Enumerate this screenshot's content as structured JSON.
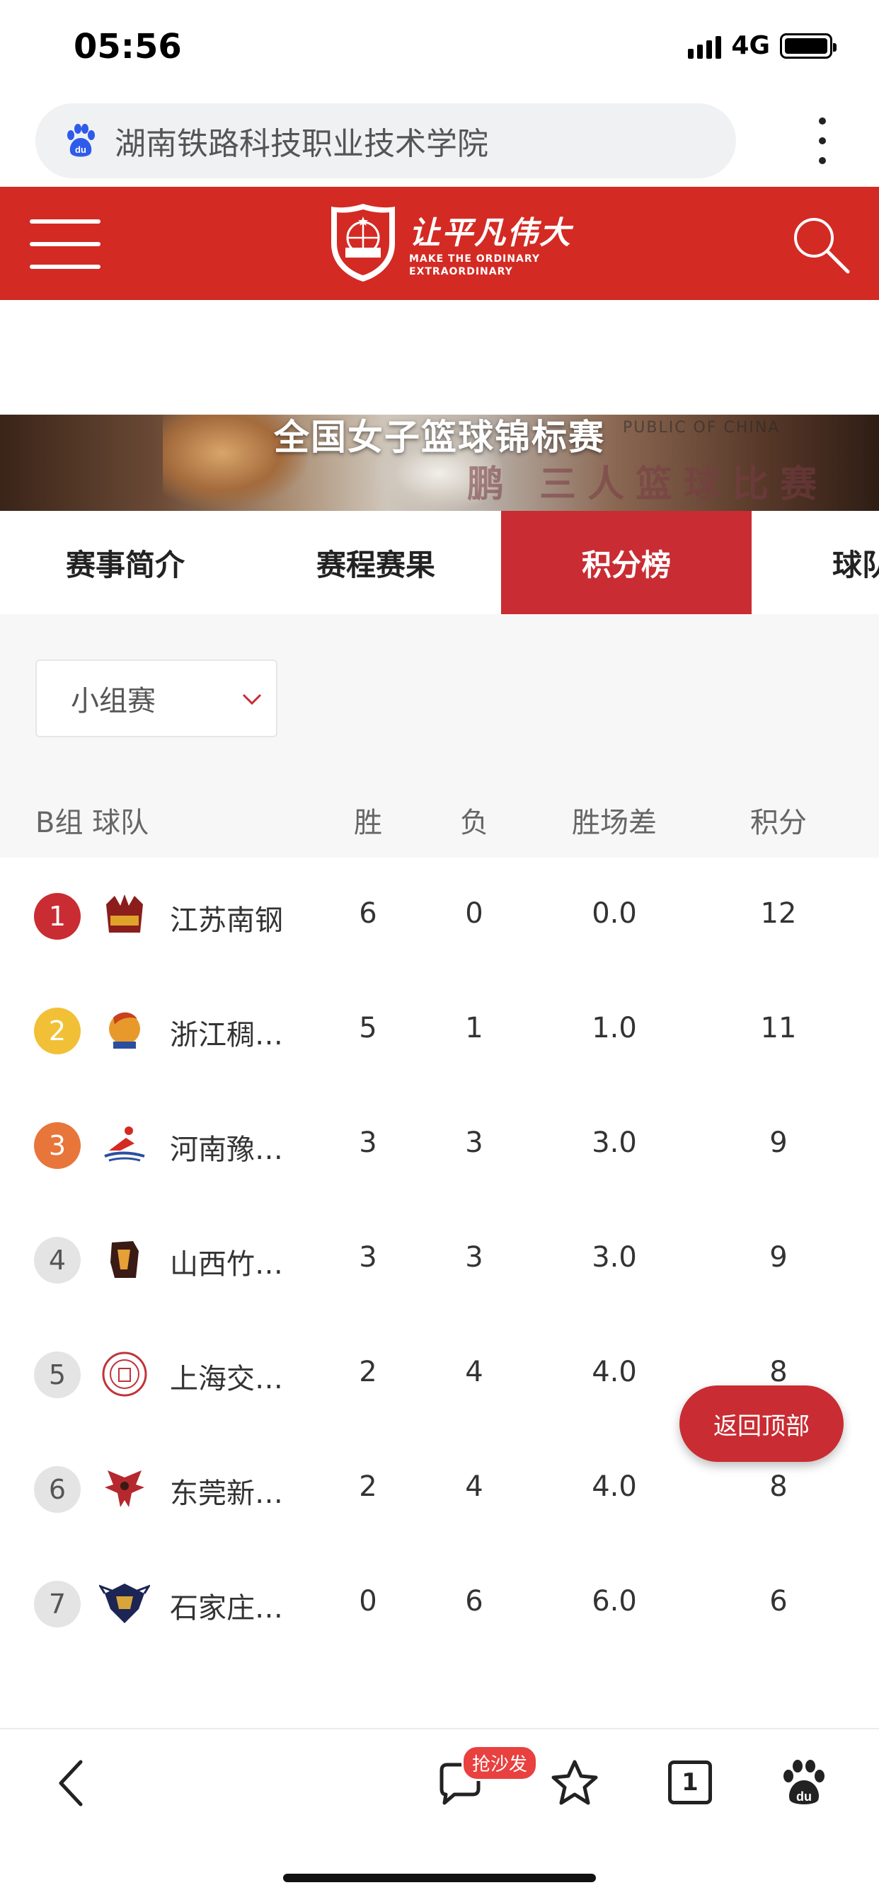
{
  "status_bar": {
    "time": "05:56",
    "network": "4G"
  },
  "address_bar": {
    "text": "湖南铁路科技职业技术学院"
  },
  "header": {
    "slogan": "让平凡伟大",
    "slogan_en_line1": "MAKE THE ORDINARY",
    "slogan_en_line2": "EXTRAORDINARY",
    "brand_color": "#d42a24"
  },
  "banner": {
    "title": "全国女子篮球锦标赛",
    "subtitle": "鹏 三人篮球比赛",
    "english_fragment": "PUBLIC OF CHINA"
  },
  "tabs": [
    {
      "label": "赛事简介",
      "active": false
    },
    {
      "label": "赛程赛果",
      "active": false
    },
    {
      "label": "积分榜",
      "active": true
    },
    {
      "label": "球队数",
      "active": false
    }
  ],
  "filter": {
    "stage": "小组赛"
  },
  "table": {
    "headers": {
      "group_team": "B组  球队",
      "wins": "胜",
      "losses": "负",
      "diff": "胜场差",
      "points": "积分"
    },
    "rows": [
      {
        "rank": "1",
        "team": "江苏南钢",
        "wins": "6",
        "losses": "0",
        "diff": "0.0",
        "points": "12"
      },
      {
        "rank": "2",
        "team": "浙江稠州金租",
        "wins": "5",
        "losses": "1",
        "diff": "1.0",
        "points": "11"
      },
      {
        "rank": "3",
        "team": "河南豫…",
        "wins": "3",
        "losses": "3",
        "diff": "3.0",
        "points": "9"
      },
      {
        "rank": "4",
        "team": "山西竹…",
        "wins": "3",
        "losses": "3",
        "diff": "3.0",
        "points": "9"
      },
      {
        "rank": "5",
        "team": "上海交…",
        "wins": "2",
        "losses": "4",
        "diff": "4.0",
        "points": "8"
      },
      {
        "rank": "6",
        "team": "东莞新…",
        "wins": "2",
        "losses": "4",
        "diff": "4.0",
        "points": "8"
      },
      {
        "rank": "7",
        "team": "石家庄…",
        "wins": "0",
        "losses": "6",
        "diff": "6.0",
        "points": "6"
      }
    ]
  },
  "back_to_top": {
    "label": "返回顶部"
  },
  "bottom_bar": {
    "comment_badge": "抢沙发",
    "tabs_count": "1"
  }
}
